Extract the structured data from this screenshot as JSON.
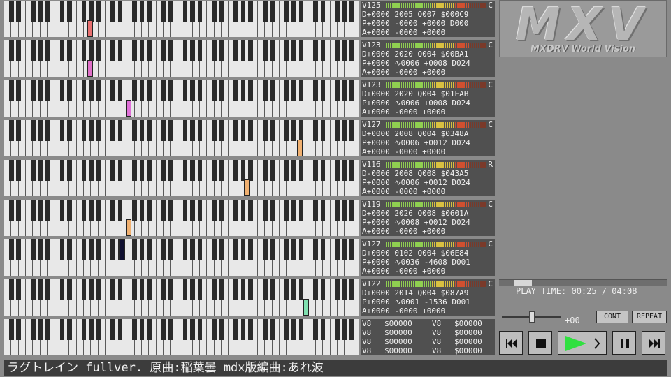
{
  "logo": {
    "title": "MXV",
    "subtitle": "MXDRV World Vision"
  },
  "channels": [
    {
      "v": "V125",
      "mode": "C",
      "d": "D+0000 2005 Q007 $000C9",
      "p": "P+0000 -0000 +0000 D000",
      "a": "A+0000 -0000 +0000",
      "note": 28,
      "note_color": "#e87070"
    },
    {
      "v": "V123",
      "mode": "C",
      "d": "D+0000 2020 Q004 $00BA1",
      "p": "P+0000 ∿0006 +0008 D024",
      "a": "A+0000 -0000 +0000",
      "note": 28,
      "note_color": "#e070c8"
    },
    {
      "v": "V123",
      "mode": "C",
      "d": "D+0000 2020 Q004 $01EAB",
      "p": "P+0000 ∿0006 +0008 D024",
      "a": "A+0000 -0000 +0000",
      "note": 41,
      "note_color": "#e070d8"
    },
    {
      "v": "V127",
      "mode": "C",
      "d": "D+0000 2008 Q004 $0348A",
      "p": "P+0000 ∿0006 +0012 D024",
      "a": "A+0000 -0000 +0000",
      "note": 99,
      "note_color": "#f0b070"
    },
    {
      "v": "V116",
      "mode": "R",
      "d": "D-0006 2008 Q008 $043A5",
      "p": "P+0000 ∿0006 +0012 D024",
      "a": "A+0000 -0000 +0000",
      "note": 81,
      "note_color": "#f0b070"
    },
    {
      "v": "V119",
      "mode": "C",
      "d": "D+0000 2026 Q008 $0601A",
      "p": "P+0000 ∿0008 +0012 D024",
      "a": "A+0000 -0000 +0000",
      "note": 41,
      "note_color": "#f0b070"
    },
    {
      "v": "V127",
      "mode": "C",
      "d": "D+0000 0102 Q004 $06E84",
      "p": "P+0000 ∿0036 -4608 D001",
      "a": "A+0000 -0000 +0000",
      "note": 39,
      "note_color": "#101030"
    },
    {
      "v": "V122",
      "mode": "C",
      "d": "D+0000 2014 Q004 $087A9",
      "p": "P+0000 ∿0001 -1536 D001",
      "a": "A+0000 -0000 +0000",
      "note": 101,
      "note_color": "#80e0b0"
    }
  ],
  "pcm_rows": [
    [
      "V8",
      "$00000",
      "V8",
      "$00000"
    ],
    [
      "V8",
      "$00000",
      "V8",
      "$00000"
    ],
    [
      "V8",
      "$00000",
      "V8",
      "$00000"
    ],
    [
      "V8",
      "$00000",
      "V8",
      "$00000"
    ]
  ],
  "playback": {
    "label": "PLAY TIME:",
    "current": "00:25",
    "total": "04:08",
    "progress": 0.1
  },
  "volume": {
    "value": "+00"
  },
  "buttons": {
    "cont": "CONT",
    "repeat": "REPEAT"
  },
  "song_title": "ラグトレイン fullver. 原曲:稲葉曇 mdx版編曲:あれ波",
  "colors": {
    "play_green": "#30e040",
    "panel": "#505050"
  }
}
